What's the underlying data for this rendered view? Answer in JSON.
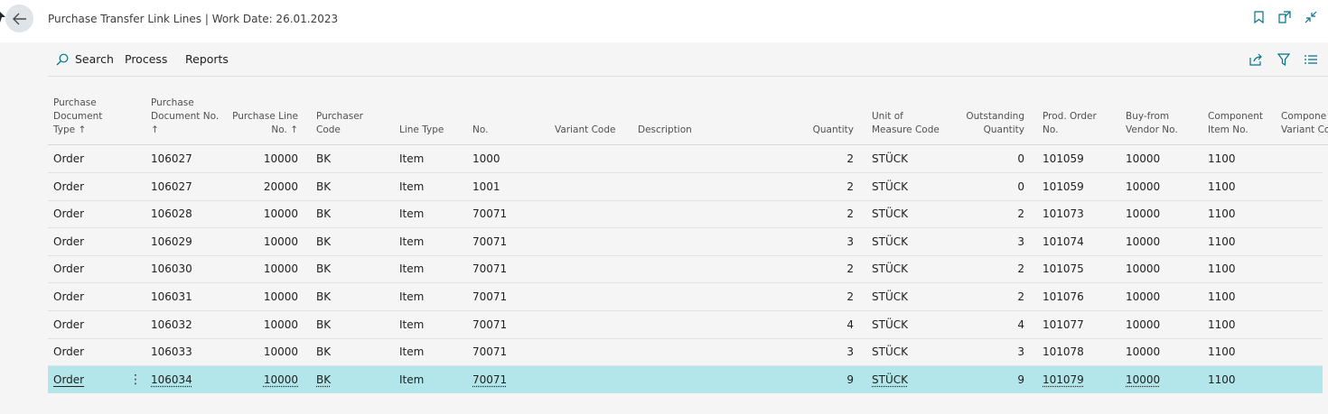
{
  "header": {
    "title": "Purchase Transfer Link Lines | Work Date: 26.01.2023"
  },
  "actions": {
    "search": "Search",
    "process": "Process",
    "reports": "Reports"
  },
  "columns": [
    "Purchase\nDocument\nType ↑",
    "Purchase\nDocument No.\n↑",
    "Purchase Line\nNo. ↑",
    "Purchaser\nCode",
    "Line Type",
    "No.",
    "Variant Code",
    "Description",
    "Quantity",
    "Unit of\nMeasure Code",
    "Outstanding\nQuantity",
    "Prod. Order\nNo.",
    "Buy-from\nVendor No.",
    "Component\nItem No.",
    "Compone\nVariant Co"
  ],
  "rows": [
    [
      "Order",
      "106027",
      "10000",
      "BK",
      "Item",
      "1000",
      "",
      "",
      "2",
      "STÜCK",
      "0",
      "101059",
      "10000",
      "1100"
    ],
    [
      "Order",
      "106027",
      "20000",
      "BK",
      "Item",
      "1001",
      "",
      "",
      "2",
      "STÜCK",
      "0",
      "101059",
      "10000",
      "1100"
    ],
    [
      "Order",
      "106028",
      "10000",
      "BK",
      "Item",
      "70071",
      "",
      "",
      "2",
      "STÜCK",
      "2",
      "101073",
      "10000",
      "1100"
    ],
    [
      "Order",
      "106029",
      "10000",
      "BK",
      "Item",
      "70071",
      "",
      "",
      "3",
      "STÜCK",
      "3",
      "101074",
      "10000",
      "1100"
    ],
    [
      "Order",
      "106030",
      "10000",
      "BK",
      "Item",
      "70071",
      "",
      "",
      "2",
      "STÜCK",
      "2",
      "101075",
      "10000",
      "1100"
    ],
    [
      "Order",
      "106031",
      "10000",
      "BK",
      "Item",
      "70071",
      "",
      "",
      "2",
      "STÜCK",
      "2",
      "101076",
      "10000",
      "1100"
    ],
    [
      "Order",
      "106032",
      "10000",
      "BK",
      "Item",
      "70071",
      "",
      "",
      "4",
      "STÜCK",
      "4",
      "101077",
      "10000",
      "1100"
    ],
    [
      "Order",
      "106033",
      "10000",
      "BK",
      "Item",
      "70071",
      "",
      "",
      "3",
      "STÜCK",
      "3",
      "101078",
      "10000",
      "1100"
    ],
    [
      "Order",
      "106034",
      "10000",
      "BK",
      "Item",
      "70071",
      "",
      "",
      "9",
      "STÜCK",
      "9",
      "101079",
      "10000",
      "1100"
    ]
  ],
  "selected_row": 8,
  "colors": {
    "selected_row": "#b2e6ea",
    "accent": "#00758c"
  }
}
